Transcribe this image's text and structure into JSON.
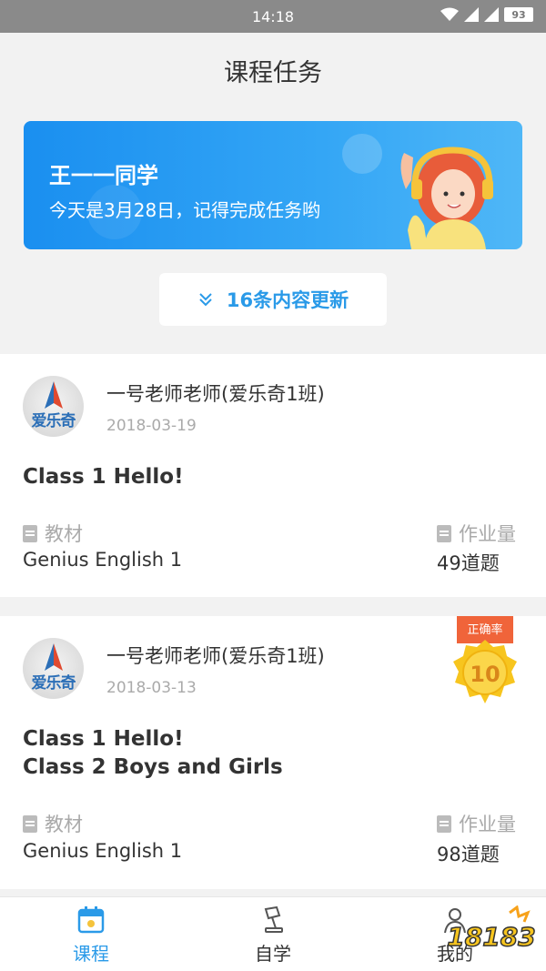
{
  "status_bar": {
    "time": "14:18",
    "battery": "93"
  },
  "header": {
    "title": "课程任务"
  },
  "banner": {
    "name": "王一一同学",
    "message": "今天是3月28日，记得完成任务哟"
  },
  "update_button": {
    "label": "16条内容更新"
  },
  "tasks": [
    {
      "school_logo": "爱乐奇",
      "teacher": "一号老师老师(爱乐奇1班)",
      "date": "2018-03-19",
      "lessons": [
        "Class 1  Hello!"
      ],
      "material_label": "教材",
      "material": "Genius English 1",
      "homework_label": "作业量",
      "homework": "49道题"
    },
    {
      "school_logo": "爱乐奇",
      "teacher": "一号老师老师(爱乐奇1班)",
      "date": "2018-03-13",
      "lessons": [
        "Class 1  Hello!",
        "Class 2  Boys and Girls"
      ],
      "material_label": "教材",
      "material": "Genius English 1",
      "homework_label": "作业量",
      "homework": "98道题",
      "accuracy_label": "正确率",
      "accuracy": "10"
    }
  ],
  "tabs": [
    {
      "label": "课程",
      "icon": "calendar-icon",
      "active": true
    },
    {
      "label": "自学",
      "icon": "desk-lamp-icon",
      "active": false
    },
    {
      "label": "我的",
      "icon": "profile-icon",
      "active": false
    }
  ],
  "watermark": "18183",
  "colors": {
    "accent": "#2a9ae8",
    "banner_start": "#1a8ff0",
    "banner_end": "#4fb7f7"
  }
}
